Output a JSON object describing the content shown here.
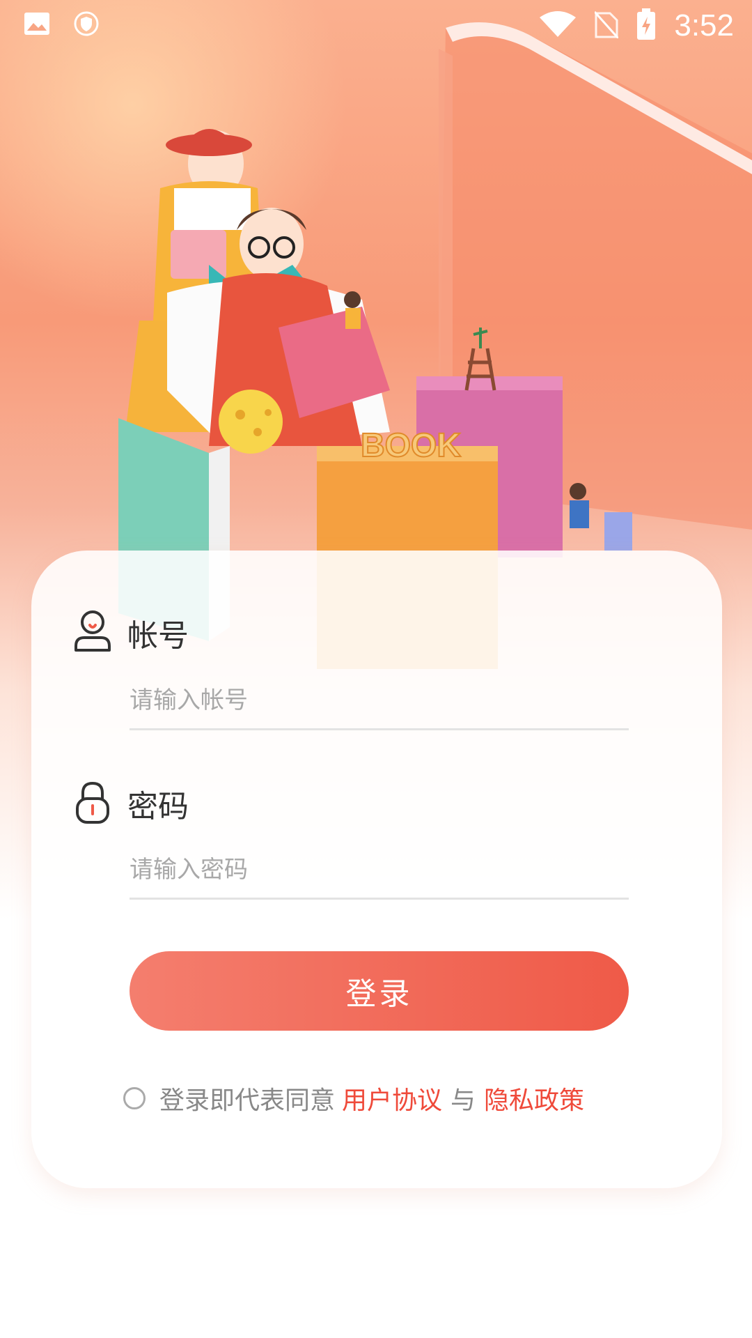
{
  "status_bar": {
    "time": "3:52",
    "icons": [
      "image-icon",
      "shield-icon",
      "wifi-icon",
      "no-sim-icon",
      "battery-charging-icon"
    ]
  },
  "login_form": {
    "account": {
      "label": "帐号",
      "placeholder": "请输入帐号",
      "icon": "user-icon"
    },
    "password": {
      "label": "密码",
      "placeholder": "请输入密码",
      "icon": "lock-icon"
    },
    "submit_label": "登录",
    "agreement": {
      "prefix": "登录即代表同意",
      "user_agreement": "用户协议",
      "separator": "与",
      "privacy_policy": "隐私政策"
    }
  },
  "hero": {
    "book_title": "BOOK"
  },
  "colors": {
    "accent": "#ef5a48",
    "accent_light": "#f47e6e",
    "link": "#ef4a3a",
    "hero_bg": "#f89a78"
  }
}
